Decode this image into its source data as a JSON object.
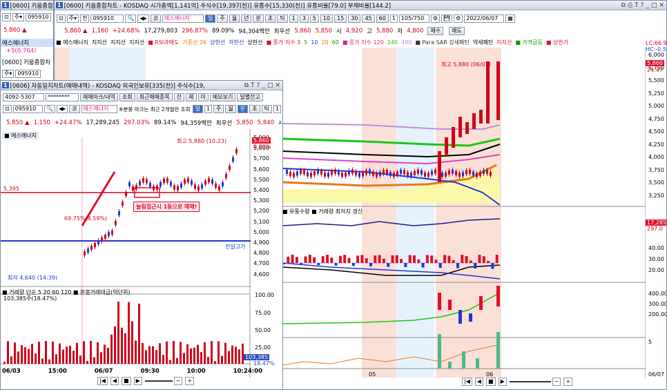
{
  "left_window": {
    "title": "[0600] 키움종합",
    "code": "095910",
    "price": "5,860 ▲",
    "name": "에스에너지",
    "pos_change": "+5(0.764)",
    "label2": "[0600] 키움종합차"
  },
  "main": {
    "title": "[0600] 키움종합차트 - KOSDAQ 시가총액[1,141억] 주식수[19,397(천)] 유통수[15,330(천)] 유통비율[79.0] 부채비율[144.2]",
    "num": "1",
    "code": "095910",
    "type_btn": "코",
    "name": "에스에너지",
    "periods": [
      "일",
      "주",
      "월",
      "년",
      "분",
      "초",
      "틱"
    ],
    "minutes": [
      "1",
      "3",
      "5",
      "10",
      "15",
      "30",
      "45",
      "60",
      "1"
    ],
    "count": "105/750",
    "date": "2022/06/07",
    "quote": {
      "price": "5,860 ▲",
      "change": "1,160",
      "rate": "+24.68%",
      "volume": "17,279,803",
      "turnover": "296.87%",
      "ratio": "89.09%",
      "amount": "94,304백만",
      "pref_label": "최우선",
      "ask": "5,860",
      "bid": "5,850",
      "open_label": "시",
      "open": "4,920",
      "high_label": "고",
      "high": "5,880",
      "low_label": "저",
      "low": "4,800",
      "buy": "매수",
      "sell": "매도"
    },
    "legend": [
      "■ 에스에너지",
      "지지선",
      "지지선",
      "지지선",
      "■ RSI과매도",
      "기준선 26",
      "상한선",
      "하한선",
      "상한선",
      "■ 종가 지수 3",
      "5",
      "10",
      "20",
      "60",
      "■ 종가 지수 120",
      "240",
      "480",
      "■ Para SAR 강세패턴",
      "약세패턴",
      "지지선",
      "■ 가격급등",
      "■ 상한가"
    ],
    "peak_label": "최고 5,880 (06/07)",
    "lc_label": "LC:66.9",
    "hc_label": "HC:-0.5",
    "yaxis": [
      "6,000",
      "5,750",
      "5,500",
      "5,250",
      "5,000",
      "4,750",
      "4,500",
      "4,250",
      "4,000",
      "3,750",
      "3,500",
      "3,250"
    ],
    "price_tag": "5,860",
    "price_tag2": "24.47",
    "volume_legend": "■ 유통수량 ■ 거래량 최저치 갱신",
    "vol_tag": "17,285",
    "vol_tag2": "297.0",
    "yaxis2": [
      "40.00",
      "30.00",
      "20.00"
    ],
    "yaxis3": [
      "400.00",
      "300.00",
      "200.00"
    ],
    "yaxis4": [
      "5"
    ],
    "xlabels": [
      "05",
      "06"
    ],
    "xdate": "06/07"
  },
  "sub": {
    "title": "[0606] 자동일지차트(매매내역) - KOSDAQ 외국인보유[335(천)] 주식수[19,",
    "account": "4092-5307",
    "password": "********",
    "btns": [
      "매매마크/내역",
      "조회",
      "최근매매종목",
      "잔",
      "체",
      "미",
      "메모보기",
      "일별잔고"
    ],
    "code": "095910",
    "name": "에스에너지",
    "mark_note": "※분봉 마크는 최근 2개월만 조회",
    "periods": [
      "일",
      "주",
      "월",
      "분",
      "초",
      "틱"
    ],
    "period_num": "1",
    "tick_num": "1",
    "quote": {
      "price": "5,850 ▲",
      "change": "1,150",
      "rate": "+24.47%",
      "volume": "17,289,245",
      "turnover": "297.03%",
      "ratio": "89.14%",
      "amount": "94,359백만",
      "pref_label": "최우선",
      "ask": "5,850",
      "bid": "5,840",
      "sell_label": "시"
    },
    "chart_name": "■ 에스에너지",
    "peak": "최고 5,880 (10:23)",
    "level": "5,395",
    "jump": "69.75%(8.59%)",
    "callout": "눌림접근시 1등으로 매매!",
    "prev_close": "전일고가",
    "low": "최저 4,640 (14:39)",
    "yaxis": [
      "5,900",
      "5,800",
      "5,700",
      "5,600",
      "5,500",
      "5,400",
      "5,300",
      "5,200",
      "5,100",
      "5,000",
      "4,900",
      "4,800",
      "4,700",
      "4,600"
    ],
    "price_tag": "5,860",
    "price_tag2": "0.00%",
    "vol_legend": "■ 거래량 단순 5 20 60 120 ■ 분봉거래대금(억단위)",
    "vol_value": "103,385주(18.47%)",
    "vol_axis": [
      "100.00",
      "75.00",
      "50.00",
      "25.00"
    ],
    "vol_tag": "103,385",
    "vol_tag2": "18.47%",
    "xlabels": [
      "06/03",
      "15:00",
      "06/07",
      "09:30",
      "10:00",
      "10:24:00"
    ]
  }
}
